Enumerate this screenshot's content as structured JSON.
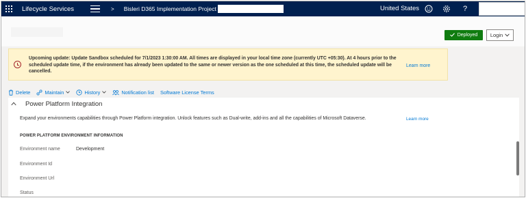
{
  "topbar": {
    "app_name": "Lifecycle Services",
    "breadcrumb_separator": ">",
    "project_name": "Bisleri D365 Implementation Project",
    "region": "United States",
    "icons": [
      "waffle-icon",
      "hamburger-icon",
      "smiley-icon",
      "gear-icon",
      "help-icon"
    ],
    "help_glyph": "?"
  },
  "header": {
    "deployed_label": "Deployed",
    "login_label": "Login"
  },
  "notice": {
    "text": "Upcoming update: Update Sandbox scheduled for 7/1/2023 1:30:00 AM. All times are displayed in your local time zone (currently UTC +05:30). At 4 hours prior to the scheduled update time, if the environment has already been updated to the same or newer version as the one scheduled at this time, the scheduled update will be cancelled.",
    "link": "Learn more"
  },
  "commands": {
    "delete": "Delete",
    "maintain": "Maintain",
    "history": "History",
    "notification_list": "Notification list",
    "software_license_terms": "Software License Terms"
  },
  "section": {
    "title": "Power Platform Integration",
    "description": "Expand your environments capabilities through Power Platform integration. Unlock features such as Dual-write, add-ins and all the capabilities of Microsoft Dataverse.",
    "link": "Learn more",
    "info_heading": "POWER PLATFORM ENVIRONMENT INFORMATION",
    "fields": [
      {
        "label": "Environment name",
        "value": "Development"
      },
      {
        "label": "Environment Id",
        "value": ""
      },
      {
        "label": "Environment Url",
        "value": ""
      },
      {
        "label": "Status",
        "value": ""
      }
    ]
  },
  "colors": {
    "topbar": "#002050",
    "deployed": "#107c10",
    "notice_bg": "#fff4ce",
    "link": "#0078d4"
  }
}
